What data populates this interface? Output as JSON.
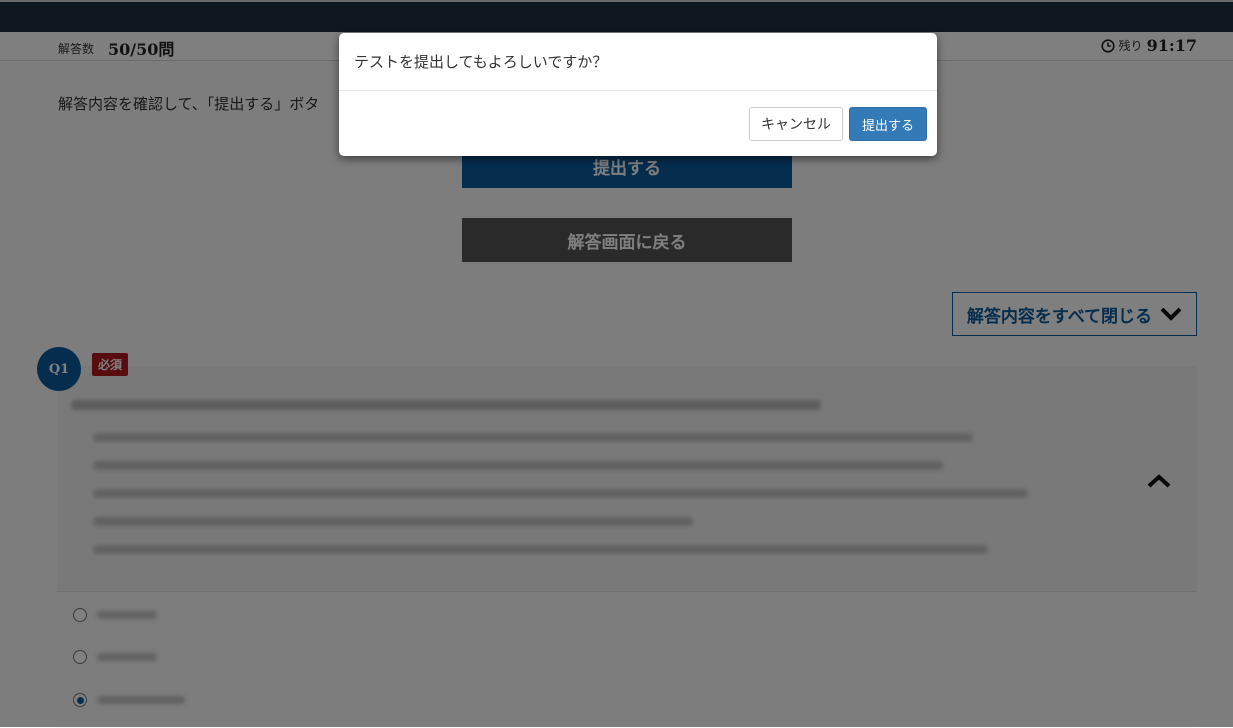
{
  "status": {
    "answered_label": "解答数",
    "answered_value": "50/50問",
    "remaining_label": "残り",
    "remaining_time": "91:17"
  },
  "main": {
    "instruction": "解答内容を確認して、「提出する」ボタ",
    "submit_label": "提出する",
    "back_label": "解答画面に戻る",
    "collapse_label": "解答内容をすべて閉じる"
  },
  "question": {
    "number": "Q1",
    "required_badge": "必須",
    "choices": [
      {
        "checked": false
      },
      {
        "checked": false
      },
      {
        "checked": true
      }
    ]
  },
  "modal": {
    "message": "テストを提出してもよろしいですか？",
    "cancel_label": "キャンセル",
    "confirm_label": "提出する"
  },
  "colors": {
    "header_bg": "#1e2f43",
    "primary": "#0a5a9c",
    "confirm_button": "#337ab7",
    "required": "#b3181e"
  },
  "icons": [
    "clock-icon",
    "chevron-down-icon",
    "chevron-up-icon"
  ]
}
